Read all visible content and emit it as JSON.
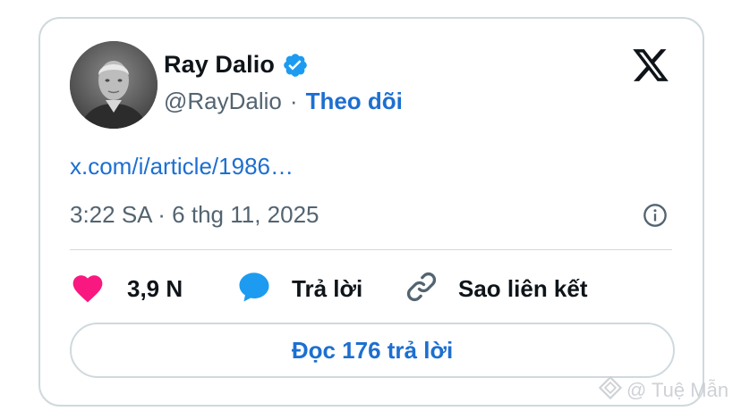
{
  "tweet": {
    "author_name": "Ray Dalio",
    "handle": "@RayDalio",
    "separator": "·",
    "follow_label": "Theo dõi",
    "link_text": "x.com/i/article/1986…",
    "timestamp": "3:22 SA · 6 thg 11, 2025"
  },
  "actions": {
    "like_count": "3,9 N",
    "reply_label": "Trả lời",
    "copy_link_label": "Sao liên kết"
  },
  "read_replies_label": "Đọc 176 trả lời",
  "watermark": {
    "text": "@ Tuệ Mẫn"
  },
  "colors": {
    "accent": "#1d6fd0",
    "verified": "#1d9bf0",
    "like": "#f91880",
    "reply": "#1d9bf0",
    "text_primary": "#0f1419",
    "text_secondary": "#536471",
    "border": "#cfd9de"
  },
  "icons": {
    "logo": "x-logo-icon",
    "verified": "verified-badge-icon",
    "info": "info-icon",
    "like": "heart-icon",
    "reply": "speech-bubble-icon",
    "copy": "link-icon"
  }
}
